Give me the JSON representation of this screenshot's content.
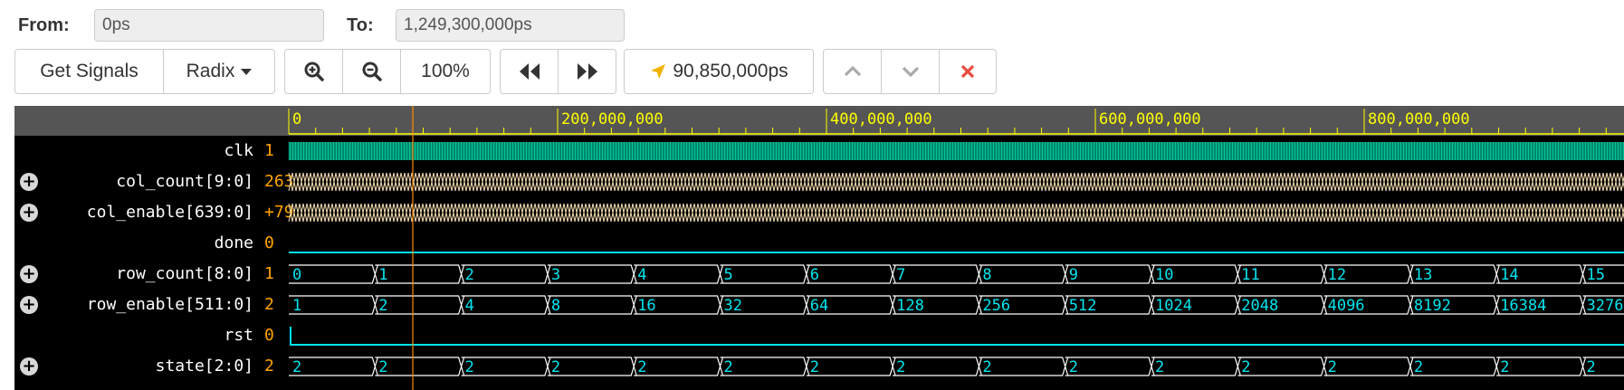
{
  "range": {
    "from_label": "From:",
    "from_value": "0ps",
    "to_label": "To:",
    "to_value": "1,249,300,000ps"
  },
  "toolbar": {
    "get_signals": "Get Signals",
    "radix": "Radix",
    "zoom": "100%",
    "cursor_time": "90,850,000ps"
  },
  "ruler": {
    "labels": [
      "0",
      "200,000,000",
      "400,000,000",
      "600,000,000",
      "800,000,000"
    ]
  },
  "signals": [
    {
      "name": "clk",
      "value": "1",
      "expandable": false,
      "kind": "clock"
    },
    {
      "name": "col_count[9:0]",
      "value": "263",
      "expandable": true,
      "kind": "dense"
    },
    {
      "name": "col_enable[639:0]",
      "value": "+79",
      "expandable": true,
      "kind": "dense"
    },
    {
      "name": "done",
      "value": "0",
      "expandable": false,
      "kind": "low"
    },
    {
      "name": "row_count[8:0]",
      "value": "1",
      "expandable": true,
      "kind": "bus",
      "segments": [
        "0",
        "1",
        "2",
        "3",
        "4",
        "5",
        "6",
        "7",
        "8",
        "9",
        "10",
        "11",
        "12",
        "13",
        "14",
        "15"
      ]
    },
    {
      "name": "row_enable[511:0]",
      "value": "2",
      "expandable": true,
      "kind": "bus",
      "segments": [
        "1",
        "2",
        "4",
        "8",
        "16",
        "32",
        "64",
        "128",
        "256",
        "512",
        "1024",
        "2048",
        "4096",
        "8192",
        "16384",
        "3276"
      ]
    },
    {
      "name": "rst",
      "value": "0",
      "expandable": false,
      "kind": "rst"
    },
    {
      "name": "state[2:0]",
      "value": "2",
      "expandable": true,
      "kind": "bus",
      "segments": [
        "2",
        "2",
        "2",
        "2",
        "2",
        "2",
        "2",
        "2",
        "2",
        "2",
        "2",
        "2",
        "2",
        "2",
        "2",
        "2"
      ]
    }
  ],
  "colors": {
    "clock": "#00c49a",
    "wave": "#00e5ee",
    "dense": "#f5deb3",
    "ruler_text": "#ffff00",
    "value_text": "#ffa500",
    "cursor": "#ff8c00",
    "delete": "#e74c3c"
  }
}
